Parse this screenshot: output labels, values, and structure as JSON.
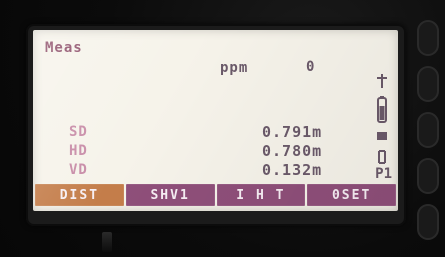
{
  "screen": {
    "title": "Meas",
    "ppm": {
      "label": "ppm",
      "value": "0"
    },
    "rows": [
      {
        "label": "SD",
        "value": "0.791m"
      },
      {
        "label": "HD",
        "value": "0.780m"
      },
      {
        "label": "VD",
        "value": "0.132m"
      }
    ],
    "page": "P1",
    "softkeys": [
      {
        "label": "DIST",
        "color": "#c47d4a"
      },
      {
        "label": "SHV1",
        "color": "#8f4f7a"
      },
      {
        "label": "I H T",
        "color": "#8f4f7a"
      },
      {
        "label": "0SET",
        "color": "#8f4f7a"
      }
    ],
    "status_icons": [
      "antenna-icon",
      "battery-icon",
      "signal-icon",
      "prism-icon"
    ]
  },
  "colors": {
    "screen_bg": "#f6f3ea",
    "title": "#8b4a66",
    "label_pink": "#c78aa6",
    "value": "#6b5a6a",
    "softkey": "#8f4f7a",
    "softkey_orange": "#c47d4a"
  }
}
